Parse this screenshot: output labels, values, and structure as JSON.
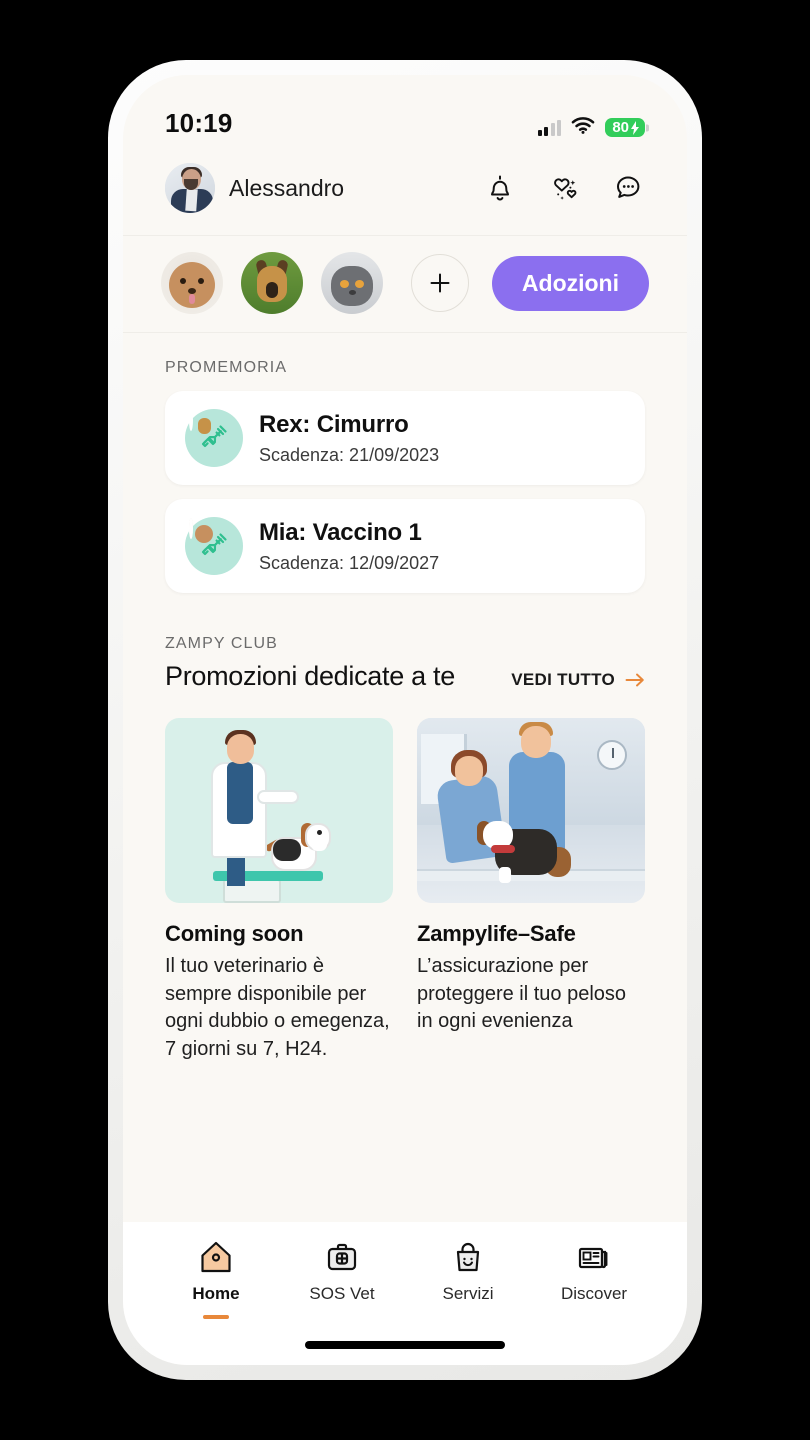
{
  "status_bar": {
    "time": "10:19",
    "battery_level": "80",
    "battery_icon": "battery-charging-icon",
    "wifi_icon": "wifi-icon",
    "signal_icon": "cellular-signal-icon"
  },
  "header": {
    "user_name": "Alessandro",
    "avatar_name": "user-avatar",
    "icons": [
      {
        "name": "bell-icon",
        "label": "Notifiche"
      },
      {
        "name": "sparkle-hearts-icon",
        "label": "Preferiti"
      },
      {
        "name": "chat-bubble-icon",
        "label": "Messaggi"
      }
    ]
  },
  "pets_row": {
    "pets": [
      {
        "name": "pet-avatar-poodle",
        "label": "Mia"
      },
      {
        "name": "pet-avatar-german-shepherd",
        "label": "Rex"
      },
      {
        "name": "pet-avatar-cat",
        "label": "Gatto"
      }
    ],
    "add_label": "+",
    "adoptions_button": "Adozioni"
  },
  "reminders": {
    "section_label": "PROMEMORIA",
    "items": [
      {
        "title": "Rex: Cimurro",
        "subtitle": "Scadenza: 21/09/2023",
        "icon": "syringe-icon",
        "pet_badge": "pet-avatar-german-shepherd"
      },
      {
        "title": "Mia: Vaccino 1",
        "subtitle": "Scadenza: 12/09/2027",
        "icon": "syringe-icon",
        "pet_badge": "pet-avatar-poodle"
      }
    ]
  },
  "zampy_club": {
    "label": "ZAMPY CLUB",
    "title": "Promozioni dedicate a te",
    "see_all": "VEDI TUTTO",
    "see_all_icon": "arrow-right-icon",
    "accent_color": "#E8883A",
    "promos": [
      {
        "title": "Coming soon",
        "description": "Il tuo veterinario è sempre disponibile per ogni dubbio o emegenza, 7 giorni su 7, H24.",
        "image_name": "vet-with-beagle-illustration"
      },
      {
        "title": "Zampylife–Safe",
        "description": "L’assicurazione per proteggere il tuo peloso in ogni evenienza",
        "image_name": "two-vets-examining-dog-photo"
      }
    ]
  },
  "bottom_nav": {
    "items": [
      {
        "label": "Home",
        "icon": "house-icon",
        "active": true
      },
      {
        "label": "SOS Vet",
        "icon": "first-aid-kit-icon",
        "active": false
      },
      {
        "label": "Servizi",
        "icon": "shopping-bag-smile-icon",
        "active": false
      },
      {
        "label": "Discover",
        "icon": "newspaper-icon",
        "active": false
      }
    ]
  },
  "colors": {
    "screen_background": "#FAF8F4",
    "card_background": "#FFFFFF",
    "accent_purple": "#8B6FEF",
    "accent_orange": "#E8883A",
    "mint": "#B7E6DA",
    "battery_green": "#32CD5A"
  }
}
